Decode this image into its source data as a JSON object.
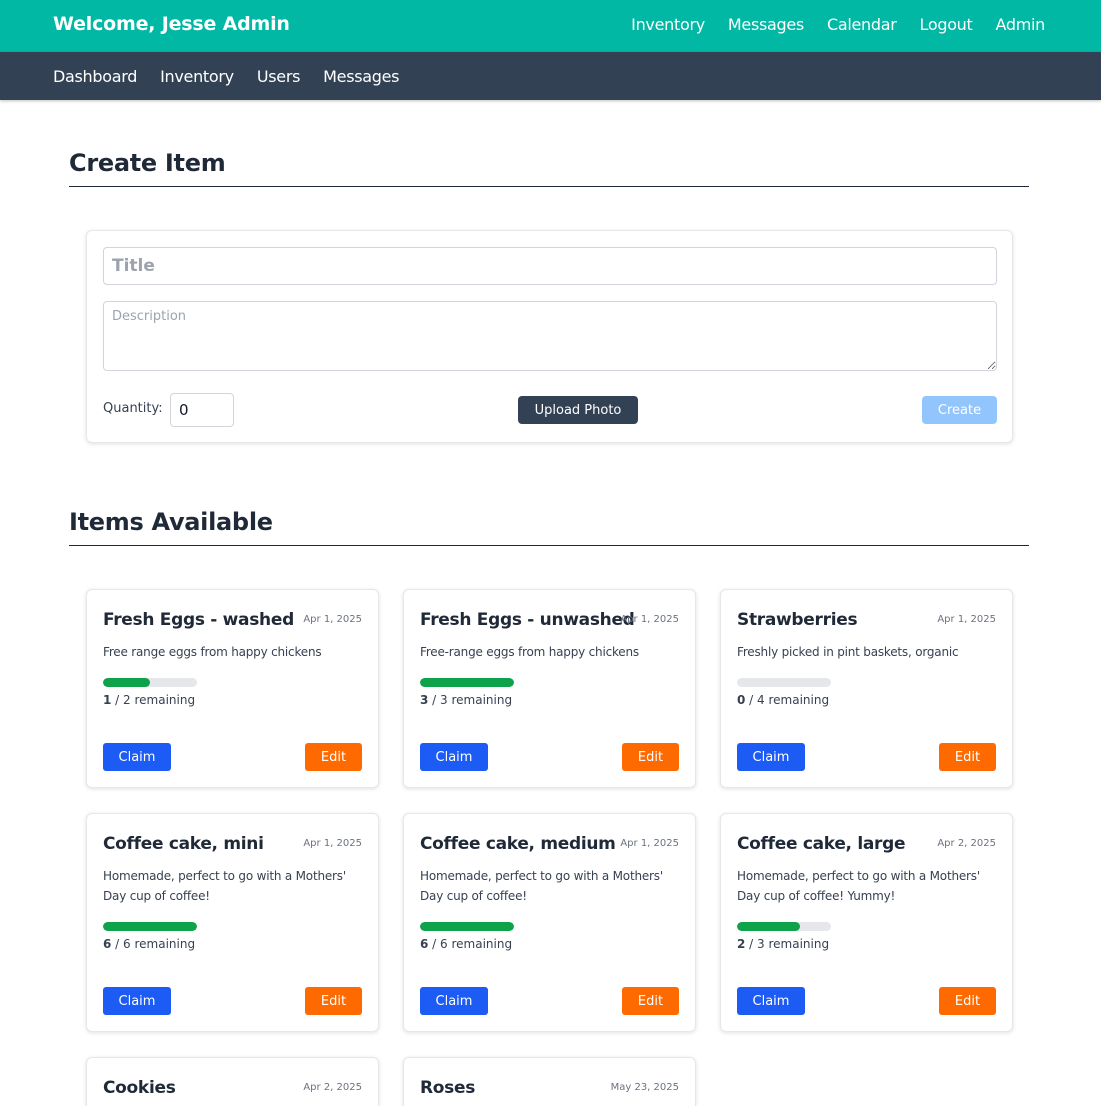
{
  "header": {
    "welcome": "Welcome, Jesse Admin",
    "nav": [
      "Inventory",
      "Messages",
      "Calendar",
      "Logout",
      "Admin"
    ],
    "color": "#00b8a4"
  },
  "subnav": {
    "items": [
      "Dashboard",
      "Inventory",
      "Users",
      "Messages"
    ],
    "color": "#334155"
  },
  "create_section": {
    "title": "Create Item",
    "title_placeholder": "Title",
    "description_placeholder": "Description",
    "quantity_label": "Quantity:",
    "quantity_value": "0",
    "upload_label": "Upload Photo",
    "create_label": "Create"
  },
  "items_section": {
    "title": "Items Available",
    "claim_label": "Claim",
    "edit_label": "Edit",
    "remaining_suffix": "remaining",
    "items": [
      {
        "title": "Fresh Eggs - washed",
        "date": "Apr 1, 2025",
        "description": "Free range eggs from happy chickens",
        "remaining": 1,
        "total": 2
      },
      {
        "title": "Fresh Eggs - unwashed",
        "date": "Apr 1, 2025",
        "description": "Free-range eggs from happy chickens",
        "remaining": 3,
        "total": 3
      },
      {
        "title": "Strawberries",
        "date": "Apr 1, 2025",
        "description": "Freshly picked in pint baskets, organic",
        "remaining": 0,
        "total": 4
      },
      {
        "title": "Coffee cake, mini",
        "date": "Apr 1, 2025",
        "description": "Homemade, perfect to go with a Mothers' Day cup of coffee!",
        "remaining": 6,
        "total": 6
      },
      {
        "title": "Coffee cake, medium",
        "date": "Apr 1, 2025",
        "description": "Homemade, perfect to go with a Mothers' Day cup of coffee!",
        "remaining": 6,
        "total": 6
      },
      {
        "title": "Coffee cake, large",
        "date": "Apr 2, 2025",
        "description": "Homemade, perfect to go with a Mothers' Day cup of coffee! Yummy!",
        "remaining": 2,
        "total": 3
      },
      {
        "title": "Cookies",
        "date": "Apr 2, 2025"
      },
      {
        "title": "Roses",
        "date": "May 23, 2025"
      }
    ]
  },
  "colors": {
    "claim": "#1d5bf5",
    "edit": "#ff6a00",
    "progress": "#0ea34a"
  }
}
